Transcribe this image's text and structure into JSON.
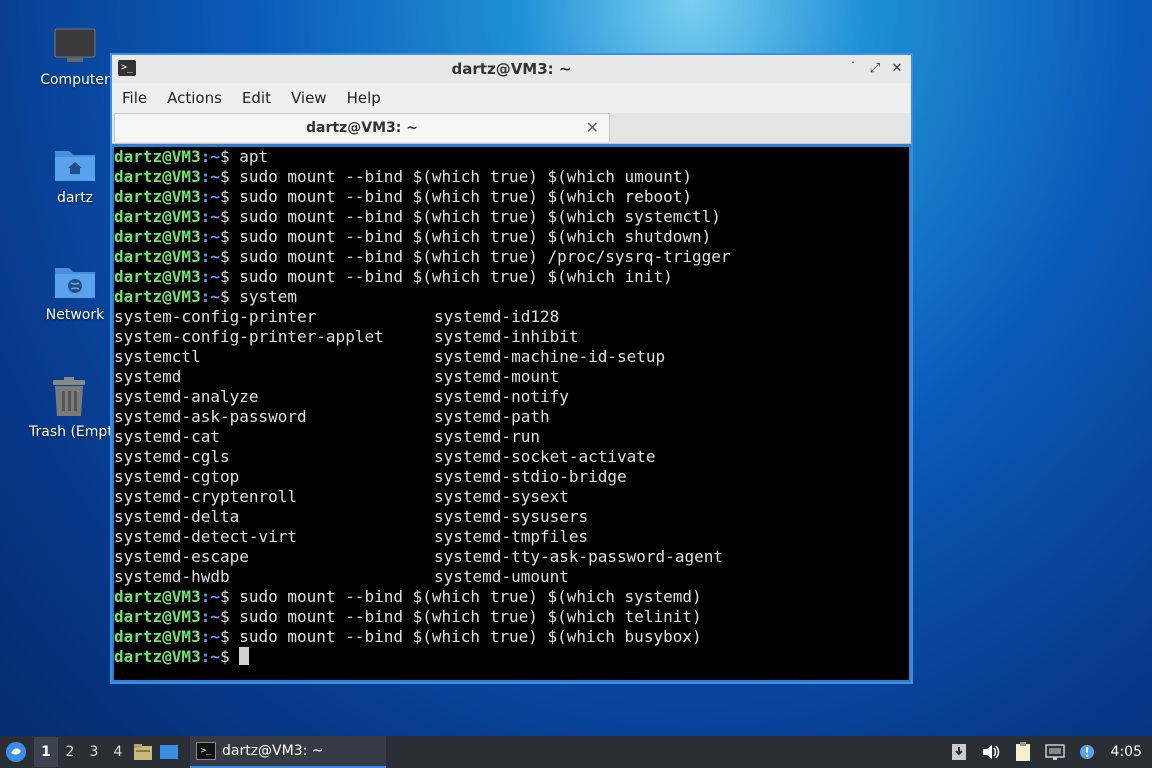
{
  "desktop": {
    "icons": [
      {
        "label": "Computer",
        "icon": "computer-icon"
      },
      {
        "label": "dartz",
        "icon": "home-folder-icon"
      },
      {
        "label": "Network",
        "icon": "network-folder-icon"
      },
      {
        "label": "Trash (Empty)",
        "icon": "trash-icon"
      }
    ]
  },
  "window": {
    "title": "dartz@VM3: ~",
    "menu": [
      "File",
      "Actions",
      "Edit",
      "View",
      "Help"
    ],
    "tab_title": "dartz@VM3: ~",
    "controls": {
      "minimize": "˙",
      "maximize": "⤢",
      "close": "✕"
    }
  },
  "terminal": {
    "prompt_user": "dartz@VM3",
    "prompt_path": ":~",
    "prompt_symbol": "$ ",
    "commands_before": [
      "apt",
      "sudo mount --bind $(which true) $(which umount)",
      "sudo mount --bind $(which true) $(which reboot)",
      "sudo mount --bind $(which true) $(which systemctl)",
      "sudo mount --bind $(which true) $(which shutdown)",
      "sudo mount --bind $(which true) /proc/sysrq-trigger",
      "sudo mount --bind $(which true) $(which init)",
      "system"
    ],
    "completions_left": [
      "system-config-printer",
      "system-config-printer-applet",
      "systemctl",
      "systemd",
      "systemd-analyze",
      "systemd-ask-password",
      "systemd-cat",
      "systemd-cgls",
      "systemd-cgtop",
      "systemd-cryptenroll",
      "systemd-delta",
      "systemd-detect-virt",
      "systemd-escape",
      "systemd-hwdb"
    ],
    "completions_right": [
      "systemd-id128",
      "systemd-inhibit",
      "systemd-machine-id-setup",
      "systemd-mount",
      "systemd-notify",
      "systemd-path",
      "systemd-run",
      "systemd-socket-activate",
      "systemd-stdio-bridge",
      "systemd-sysext",
      "systemd-sysusers",
      "systemd-tmpfiles",
      "systemd-tty-ask-password-agent",
      "systemd-umount"
    ],
    "commands_after": [
      "sudo mount --bind $(which true) $(which systemd)",
      "sudo mount --bind $(which true) $(which telinit)",
      "sudo mount --bind $(which true) $(which busybox)"
    ]
  },
  "taskbar": {
    "workspaces": [
      "1",
      "2",
      "3",
      "4"
    ],
    "active_workspace": "1",
    "task_label": "dartz@VM3: ~",
    "clock": "4:05"
  },
  "colors": {
    "prompt_user": "#6ee36e",
    "prompt_path": "#5a9dff",
    "window_border": "#3d8fe0",
    "taskbar_bg": "#2a2e35"
  }
}
